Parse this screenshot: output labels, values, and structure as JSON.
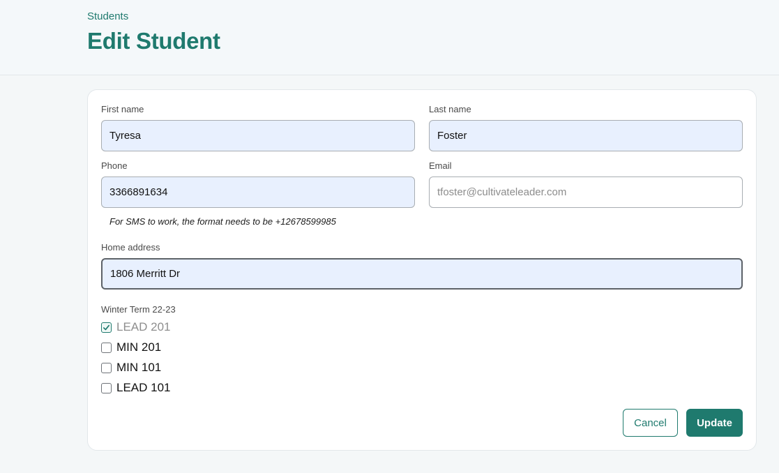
{
  "header": {
    "breadcrumb": "Students",
    "title": "Edit Student"
  },
  "form": {
    "first_name": {
      "label": "First name",
      "value": "Tyresa"
    },
    "last_name": {
      "label": "Last name",
      "value": "Foster"
    },
    "phone": {
      "label": "Phone",
      "value": "3366891634",
      "hint": "For SMS to work, the format needs to be +12678599985"
    },
    "email": {
      "label": "Email",
      "value": "",
      "placeholder": "tfoster@cultivateleader.com"
    },
    "home_address": {
      "label": "Home address",
      "value": "1806 Merritt Dr"
    },
    "term": {
      "label": "Winter Term 22-23",
      "courses": [
        {
          "label": "LEAD 201",
          "checked": true
        },
        {
          "label": "MIN 201",
          "checked": false
        },
        {
          "label": "MIN 101",
          "checked": false
        },
        {
          "label": "LEAD 101",
          "checked": false
        }
      ]
    }
  },
  "actions": {
    "cancel_label": "Cancel",
    "update_label": "Update"
  },
  "colors": {
    "accent": "#1f7a6e",
    "autofill": "#e8f0fe"
  }
}
